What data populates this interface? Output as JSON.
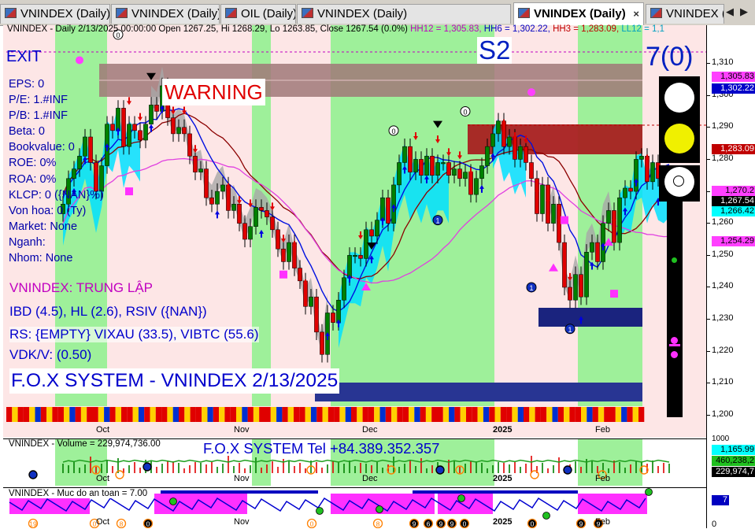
{
  "tabs": [
    {
      "label": "VNINDEX (Daily)",
      "active": false
    },
    {
      "label": "VNINDEX (Daily)",
      "active": false
    },
    {
      "label": "OIL (Daily)",
      "active": false
    },
    {
      "label": "VNINDEX (Daily)",
      "active": false
    },
    {
      "label": "VNINDEX (Daily)",
      "active": true
    },
    {
      "label": "VNINDEX (D",
      "active": false
    }
  ],
  "tab_close_glyph": "×",
  "tab_nav": {
    "prev": "◀",
    "next": "▶"
  },
  "header": {
    "main": "VNINDEX - Daily 2/13/2025 00:00:00 Open 1267.25, Hi 1268.29, Lo 1263.85, Close 1267.54 (0.0%)",
    "hh12": "HH12 = 1,305.83,",
    "hh6": "HH6 = 1,302.22,",
    "hh3": "HH3 = 1,283.09,",
    "ll12": "LL12 = 1,1"
  },
  "overlays": {
    "exit": "EXIT",
    "s2": "S2",
    "warning": "WARNING",
    "score": "7(0)",
    "title": "F.O.X SYSTEM - VNINDEX 2/13/2025",
    "status": "VNINDEX: TRUNG LẬP",
    "line1": "IBD (4.5), HL (2.6), RSIV ({NAN})",
    "line2": "RS: {EMPTY} VIXAU (33.5), VIBTC (55.6)",
    "line3": "VDK/V:  (0.50)"
  },
  "fundamentals": [
    "EPS: 0",
    "P/E: 1.#INF",
    "P/B: 1.#INF",
    "Beta: 0",
    "Bookvalue: 0",
    "ROE: 0%",
    "ROA: 0%",
    "KLCP: 0 ({NAN}%)",
    "Von hoa: 0 (Ty)",
    "Market: None",
    "Nganh:",
    "Nhom: None"
  ],
  "volume_panel": {
    "header": "VNINDEX - Volume = 229,974,736.00",
    "phone": "F.O.X SYSTEM Tel +84.389.352.357",
    "label_top": "460,238,2",
    "label_bottom": "229,974,7",
    "tick_mid": "1000"
  },
  "mucdo_panel": {
    "header": "VNINDEX - Muc do an toan = 7.00",
    "label": "7",
    "tick_zero": "0",
    "bottom_labels": [
      "19",
      "0",
      "8",
      "0",
      "0",
      "8",
      "9",
      "6",
      "9",
      "9",
      "0",
      "0",
      "9",
      "9"
    ]
  },
  "x_labels": [
    "Oct",
    "Nov",
    "Dec",
    "2025",
    "Feb"
  ],
  "signal_labels": [
    "0",
    "0",
    "0",
    "1",
    "1",
    "1"
  ],
  "chart_data": {
    "type": "candlestick",
    "title": "",
    "yticks": [
      1310,
      1300,
      1290,
      1280,
      1270,
      1260,
      1250,
      1240,
      1230,
      1220,
      1210,
      1200
    ],
    "ylim": [
      1195,
      1316
    ],
    "price_labels": [
      {
        "text": "1,305.83",
        "bg": "#ff40ff",
        "fg": "#000000"
      },
      {
        "text": "1,302.22",
        "bg": "#0000c8",
        "fg": "#ffffff"
      },
      {
        "text": "1,283.09",
        "bg": "#c00000",
        "fg": "#ffffff"
      },
      {
        "text": "1,270.2",
        "bg": "#ff40ff",
        "fg": "#000000"
      },
      {
        "text": "1,267.54",
        "bg": "#000000",
        "fg": "#ffffff"
      },
      {
        "text": "1,266.42",
        "bg": "#00ffff",
        "fg": "#000000"
      },
      {
        "text": "1,254.29",
        "bg": "#ff40ff",
        "fg": "#000000"
      },
      {
        "text": "1,165.99",
        "bg": "#00ffff",
        "fg": "#000000"
      }
    ],
    "close": [
      1258,
      1266,
      1269,
      1273,
      1279,
      1271,
      1262,
      1270,
      1283,
      1281,
      1288,
      1276,
      1283,
      1281,
      1278,
      1283,
      1289,
      1287,
      1295,
      1285,
      1280,
      1282,
      1280,
      1273,
      1268,
      1269,
      1260,
      1258,
      1262,
      1264,
      1256,
      1258,
      1252,
      1247,
      1251,
      1257,
      1256,
      1254,
      1250,
      1244,
      1240,
      1246,
      1238,
      1234,
      1226,
      1229,
      1218,
      1211,
      1224,
      1221,
      1228,
      1235,
      1242,
      1242,
      1241,
      1250,
      1248,
      1253,
      1260,
      1252,
      1264,
      1271,
      1276,
      1268,
      1272,
      1267,
      1273,
      1267,
      1271,
      1271,
      1267,
      1269,
      1266,
      1268,
      1261,
      1266,
      1270,
      1276,
      1280,
      1284,
      1276,
      1279,
      1272,
      1276,
      1271,
      1266,
      1255,
      1264,
      1252,
      1258,
      1246,
      1232,
      1228,
      1236,
      1229,
      1243,
      1246,
      1240,
      1252,
      1256,
      1246,
      1260,
      1263,
      1262,
      1272,
      1273,
      1265,
      1271,
      1266,
      1265,
      1267
    ],
    "colors": {
      "bull": "#008000",
      "bear": "#e00000",
      "up_arrow": "#0000e0",
      "down_arrow": "#e00000"
    }
  }
}
